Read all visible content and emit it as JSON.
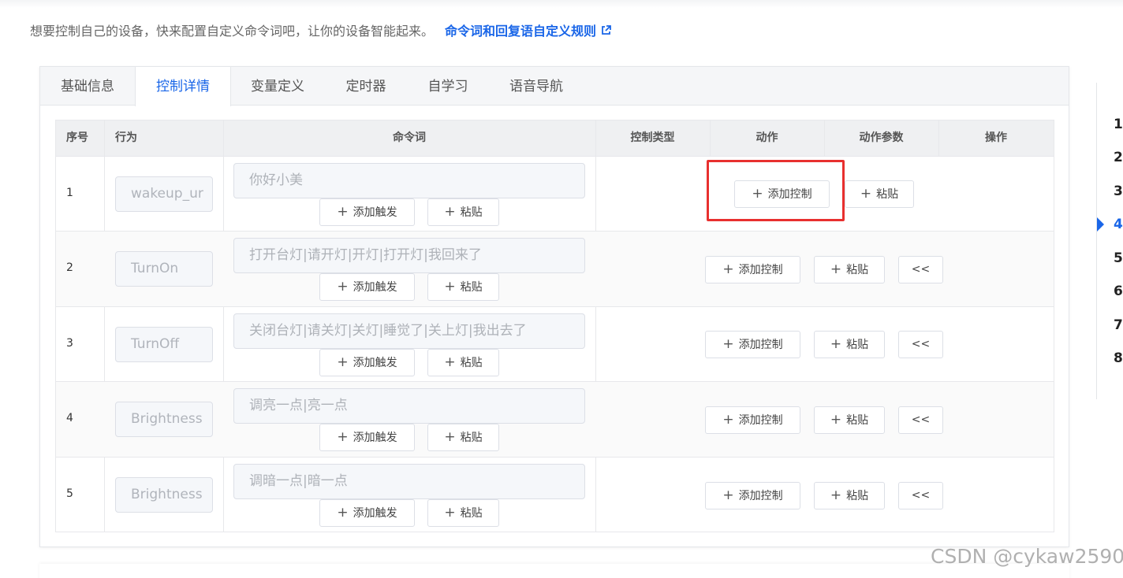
{
  "intro": {
    "text": "想要控制自己的设备，快来配置自定义命令词吧，让你的设备智能起来。",
    "link_label": "命令词和回复语自定义规则",
    "link_icon": "external-link-icon"
  },
  "tabs": [
    {
      "label": "基础信息",
      "active": false
    },
    {
      "label": "控制详情",
      "active": true
    },
    {
      "label": "变量定义",
      "active": false
    },
    {
      "label": "定时器",
      "active": false
    },
    {
      "label": "自学习",
      "active": false
    },
    {
      "label": "语音导航",
      "active": false
    }
  ],
  "table": {
    "headers": {
      "index": "序号",
      "behavior": "行为",
      "command": "命令词",
      "control_type": "控制类型",
      "action": "动作",
      "action_params": "动作参数",
      "operation": "操作"
    },
    "rows": [
      {
        "index": "1",
        "behavior": "wakeup_ur",
        "command": "你好小美",
        "add_trigger": "添加触发",
        "paste": "粘贴",
        "add_control": "添加控制",
        "action_paste": "粘贴",
        "collapse": ""
      },
      {
        "index": "2",
        "behavior": "TurnOn",
        "command": "打开台灯|请开灯|开灯|打开灯|我回来了",
        "add_trigger": "添加触发",
        "paste": "粘贴",
        "add_control": "添加控制",
        "action_paste": "粘贴",
        "collapse": "<<"
      },
      {
        "index": "3",
        "behavior": "TurnOff",
        "command": "关闭台灯|请关灯|关灯|睡觉了|关上灯|我出去了",
        "add_trigger": "添加触发",
        "paste": "粘贴",
        "add_control": "添加控制",
        "action_paste": "粘贴",
        "collapse": "<<"
      },
      {
        "index": "4",
        "behavior": "Brightness",
        "command": "调亮一点|亮一点",
        "add_trigger": "添加触发",
        "paste": "粘贴",
        "add_control": "添加控制",
        "action_paste": "粘贴",
        "collapse": "<<"
      },
      {
        "index": "5",
        "behavior": "Brightness",
        "command": "调暗一点|暗一点",
        "add_trigger": "添加触发",
        "paste": "粘贴",
        "add_control": "添加控制",
        "action_paste": "粘贴",
        "collapse": "<<"
      }
    ]
  },
  "anchors": [
    "1",
    "2",
    "3",
    "4",
    "5",
    "6",
    "7",
    "8"
  ],
  "anchor_active": "4",
  "watermark": "CSDN @cykaw2590",
  "colors": {
    "accent": "#1a66e8",
    "highlight": "#e8302f"
  }
}
